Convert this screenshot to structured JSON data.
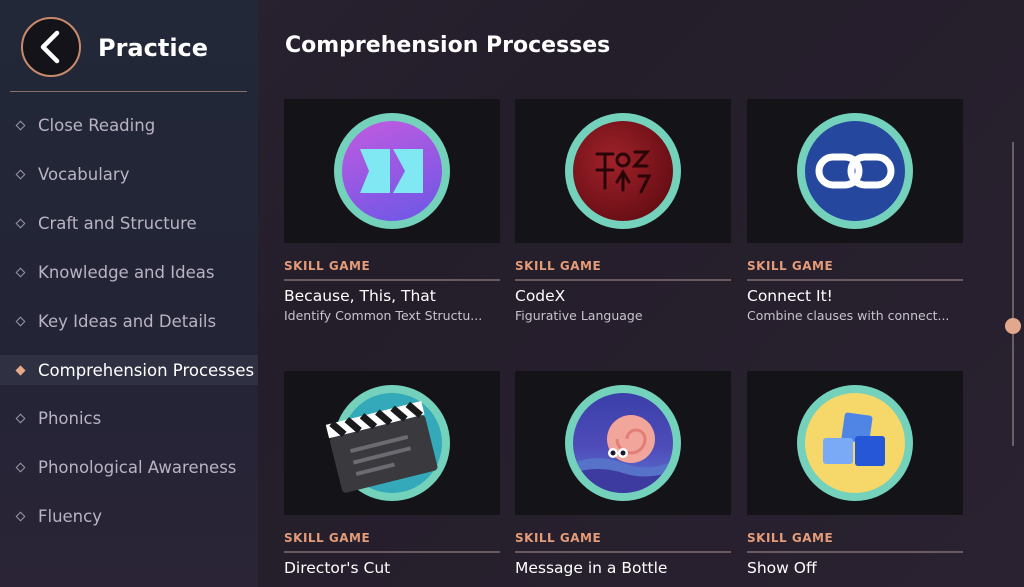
{
  "sidebar": {
    "title": "Practice",
    "items": [
      {
        "label": "Close Reading",
        "active": false
      },
      {
        "label": "Vocabulary",
        "active": false
      },
      {
        "label": "Craft and Structure",
        "active": false
      },
      {
        "label": "Knowledge and Ideas",
        "active": false
      },
      {
        "label": "Key Ideas and Details",
        "active": false
      },
      {
        "label": "Comprehension Processes",
        "active": true
      },
      {
        "label": "Phonics",
        "active": false
      },
      {
        "label": "Phonological Awareness",
        "active": false
      },
      {
        "label": "Fluency",
        "active": false
      }
    ]
  },
  "main": {
    "title": "Comprehension Processes",
    "cards": [
      {
        "tag": "SKILL GAME",
        "title": "Because, This, That",
        "subtitle": "Identify Common Text Structu...",
        "icon": "because-this-that-icon"
      },
      {
        "tag": "SKILL GAME",
        "title": "CodeX",
        "subtitle": "Figurative Language",
        "icon": "wax-seal-icon"
      },
      {
        "tag": "SKILL GAME",
        "title": "Connect It!",
        "subtitle": "Combine clauses with connect...",
        "icon": "chain-link-icon"
      },
      {
        "tag": "SKILL GAME",
        "title": "Director's Cut",
        "subtitle": "",
        "icon": "clapperboard-icon"
      },
      {
        "tag": "SKILL GAME",
        "title": "Message in a Bottle",
        "subtitle": "",
        "icon": "snail-icon"
      },
      {
        "tag": "SKILL GAME",
        "title": "Show Off",
        "subtitle": "",
        "icon": "blocks-icon"
      }
    ]
  },
  "colors": {
    "accent": "#e39b78",
    "ring": "#74d1bb",
    "active_marker": "#e5a98c"
  }
}
